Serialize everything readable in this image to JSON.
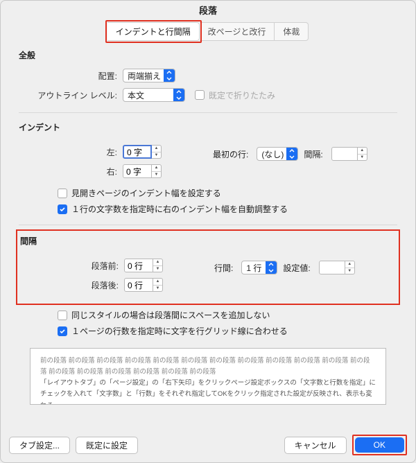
{
  "title": "段落",
  "tabs": [
    {
      "label": "インデントと行間隔",
      "active": true
    },
    {
      "label": "改ページと改行",
      "active": false
    },
    {
      "label": "体裁",
      "active": false
    }
  ],
  "general": {
    "heading": "全般",
    "alignment_label": "配置:",
    "alignment_value": "両端揃え",
    "outline_label": "アウトライン レベル:",
    "outline_value": "本文",
    "collapse_label": "既定で折りたたみ"
  },
  "indent": {
    "heading": "インデント",
    "left_label": "左:",
    "left_value": "0 字",
    "right_label": "右:",
    "right_value": "0 字",
    "firstline_label": "最初の行:",
    "firstline_value": "(なし)",
    "spacing_label": "間隔:",
    "spacing_value": "",
    "mirror_label": "見開きページのインデント幅を設定する",
    "autofit_label": "１行の文字数を指定時に右のインデント幅を自動調整する"
  },
  "spacing": {
    "heading": "間隔",
    "before_label": "段落前:",
    "before_value": "0 行",
    "after_label": "段落後:",
    "after_value": "0 行",
    "line_label": "行間:",
    "line_value": "1 行",
    "at_label": "設定値:",
    "at_value": "",
    "nospace_label": "同じスタイルの場合は段落間にスペースを追加しない",
    "snapgrid_label": "１ページの行数を指定時に文字を行グリッド線に合わせる"
  },
  "preview": {
    "line_prev": "前の段落 前の段落 前の段落 前の段落 前の段落 前の段落 前の段落 前の段落 前の段落 前の段落 前の段落 前の段落 前の段落 前の段落 前の段落 前の段落 前の段落 前の段落",
    "line_body": "「レイアウトタブ」の「ページ設定」の「右下矢印」をクリックページ設定ボックスの「文字数と行数を指定」にチェックを入れて「文字数」と「行数」をそれぞれ指定してOKをクリック指定された設定が反映され、表示も変わる"
  },
  "footer": {
    "tabs": "タブ設定...",
    "default": "既定に設定",
    "cancel": "キャンセル",
    "ok": "OK"
  }
}
